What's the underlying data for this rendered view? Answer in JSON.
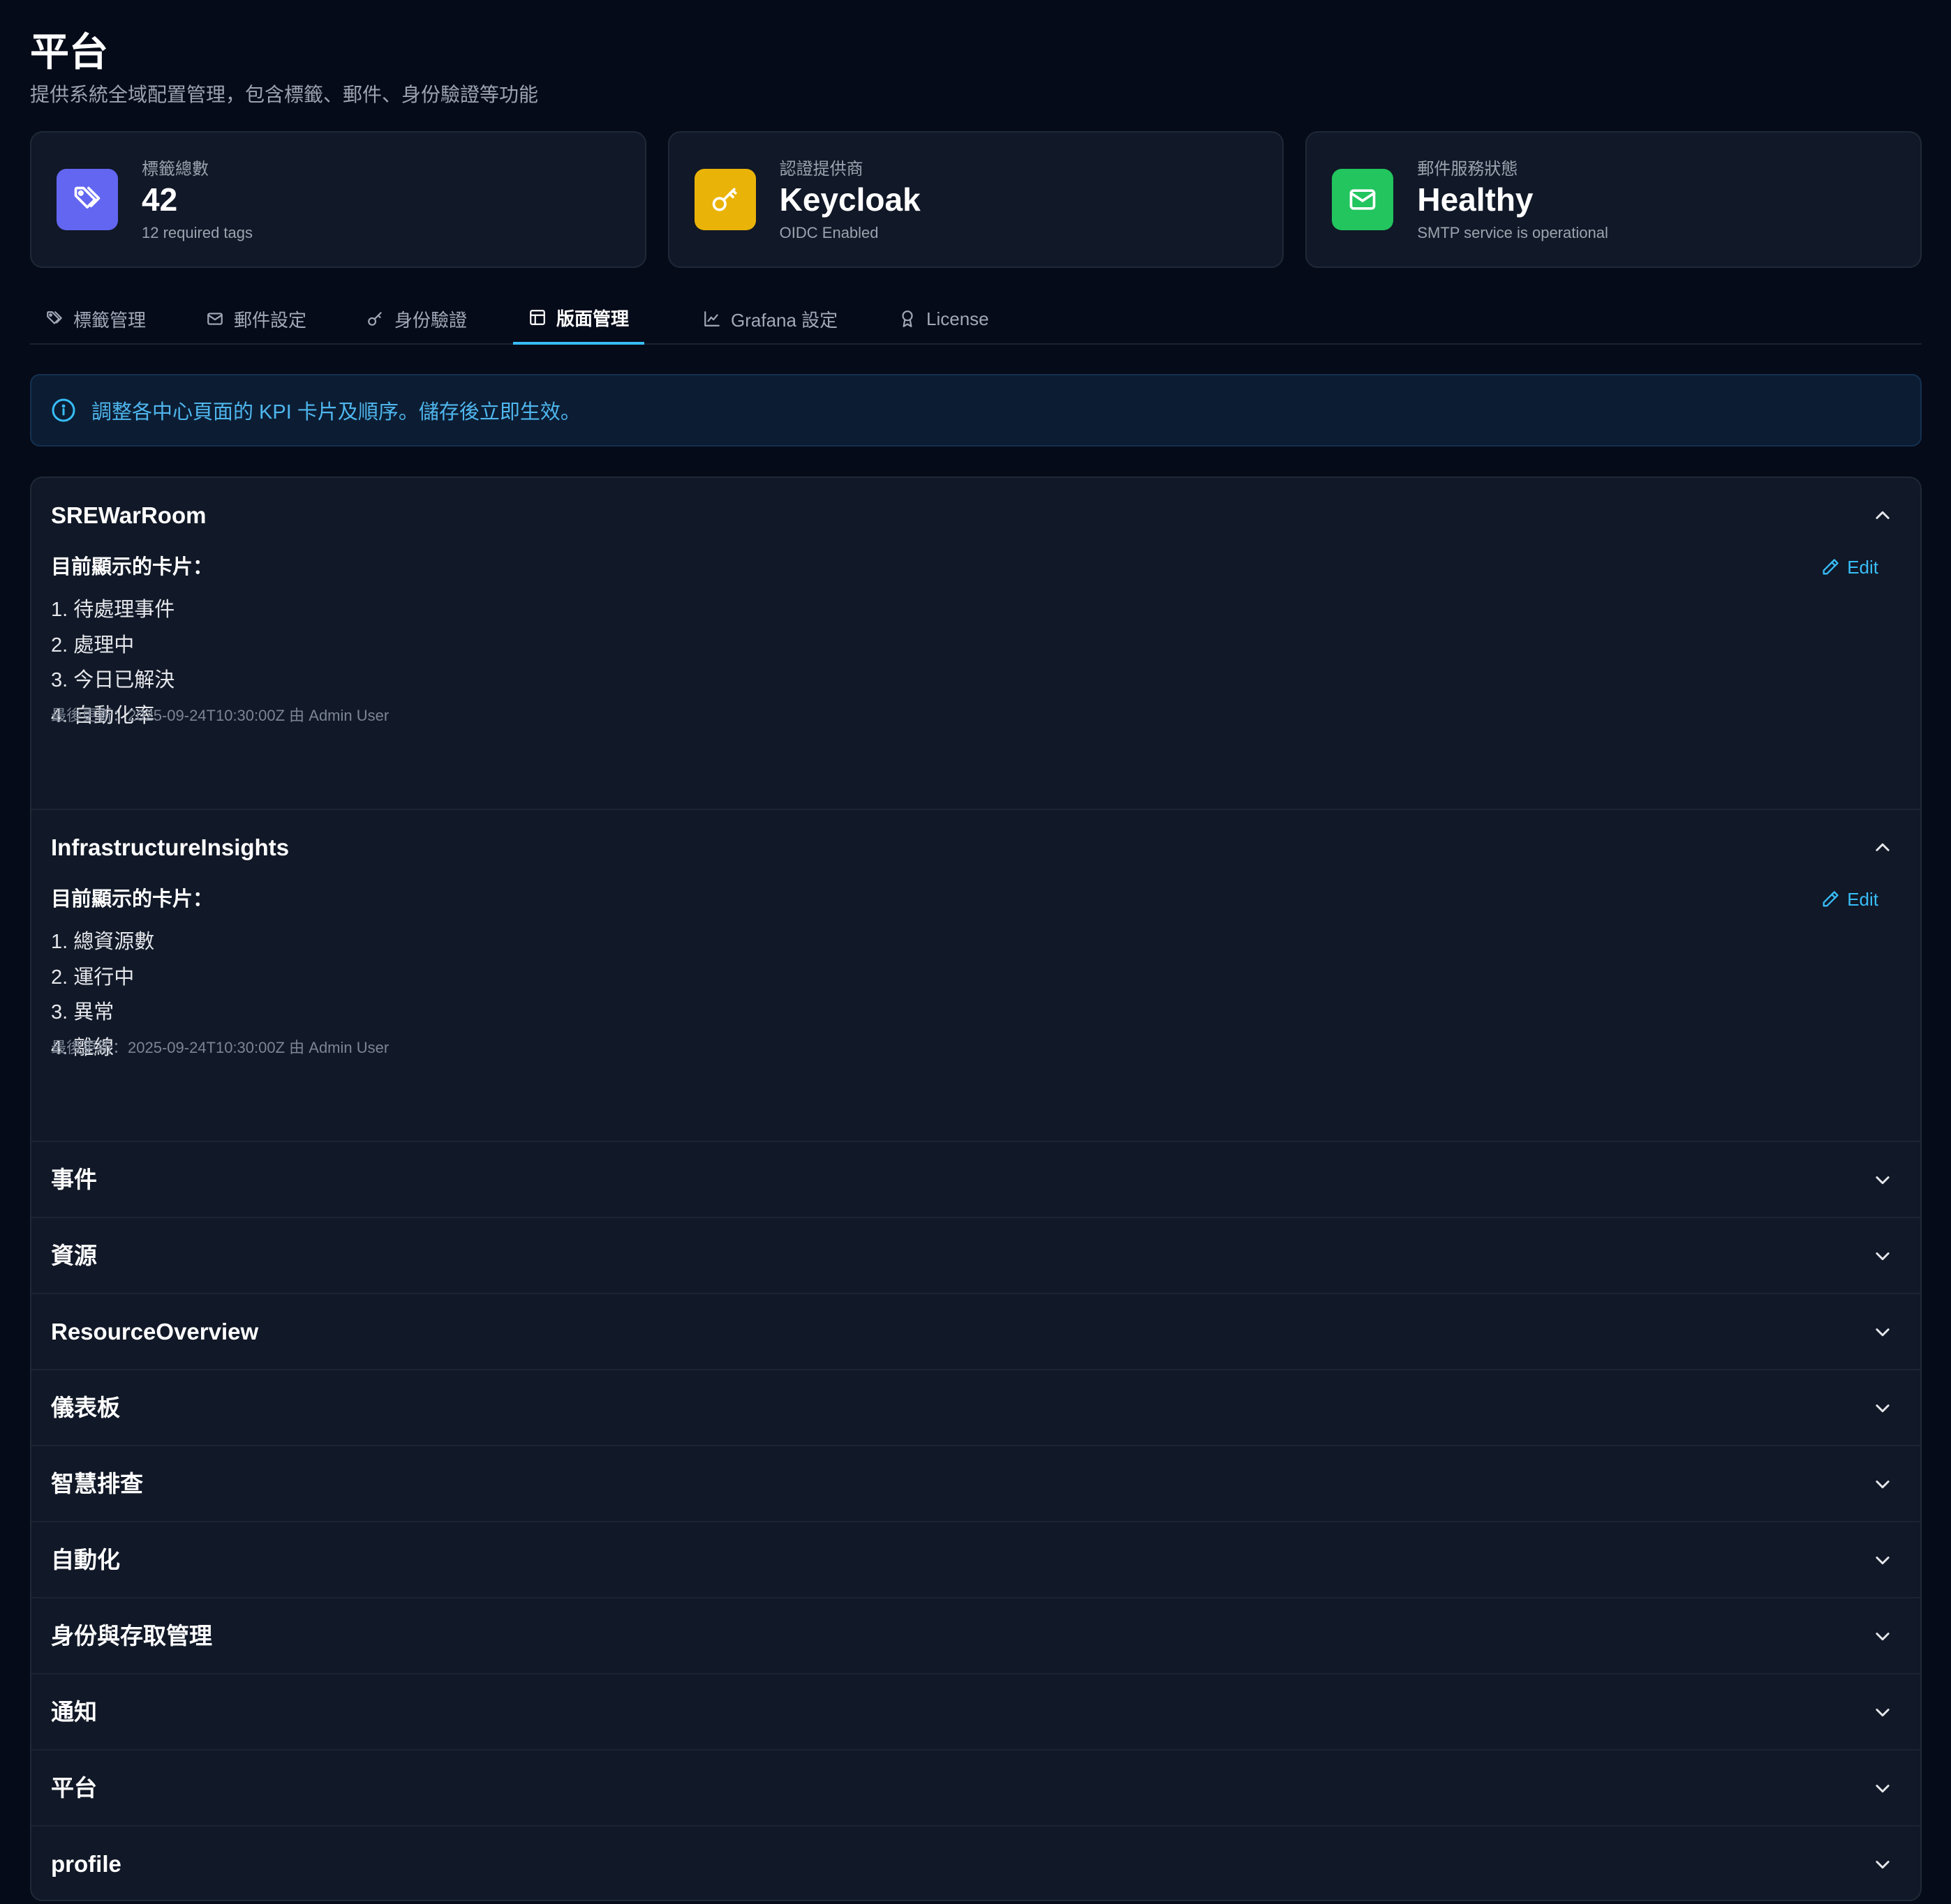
{
  "page": {
    "title": "平台",
    "subtitle": "提供系統全域配置管理，包含標籤、郵件、身份驗證等功能"
  },
  "stats": [
    {
      "label": "標籤總數",
      "value": "42",
      "note": "12 required tags",
      "icon": "tag-icon",
      "color": "#6366f1"
    },
    {
      "label": "認證提供商",
      "value": "Keycloak",
      "note": "OIDC Enabled",
      "icon": "key-icon",
      "color": "#eab308"
    },
    {
      "label": "郵件服務狀態",
      "value": "Healthy",
      "note": "SMTP service is operational",
      "icon": "mail-icon",
      "color": "#22c55e"
    }
  ],
  "tabs": [
    {
      "label": "標籤管理",
      "icon": "tag-icon"
    },
    {
      "label": "郵件設定",
      "icon": "mail-icon"
    },
    {
      "label": "身份驗證",
      "icon": "key-icon"
    },
    {
      "label": "版面管理",
      "icon": "layout-icon",
      "active": true
    },
    {
      "label": "Grafana 設定",
      "icon": "chart-icon"
    },
    {
      "label": "License",
      "icon": "award-icon"
    }
  ],
  "info": {
    "text": "調整各中心頁面的 KPI 卡片及順序。儲存後立即生效。"
  },
  "sections": [
    {
      "title": "SREWarRoom",
      "expanded": true,
      "cards_heading": "目前顯示的卡片：",
      "cards": [
        "1. 待處理事件",
        "2. 處理中",
        "3. 今日已解決",
        "4. 自動化率"
      ],
      "updated": "最後更新：2025-09-24T10:30:00Z 由 Admin User",
      "edit_label": "Edit"
    },
    {
      "title": "InfrastructureInsights",
      "expanded": true,
      "cards_heading": "目前顯示的卡片：",
      "cards": [
        "1. 總資源數",
        "2. 運行中",
        "3. 異常",
        "4. 離線"
      ],
      "updated": "最後更新：2025-09-24T10:30:00Z 由 Admin User",
      "edit_label": "Edit"
    },
    {
      "title": "事件"
    },
    {
      "title": "資源"
    },
    {
      "title": "ResourceOverview"
    },
    {
      "title": "儀表板"
    },
    {
      "title": "智慧排查"
    },
    {
      "title": "自動化"
    },
    {
      "title": "身份與存取管理"
    },
    {
      "title": "通知"
    },
    {
      "title": "平台"
    },
    {
      "title": "profile"
    }
  ]
}
